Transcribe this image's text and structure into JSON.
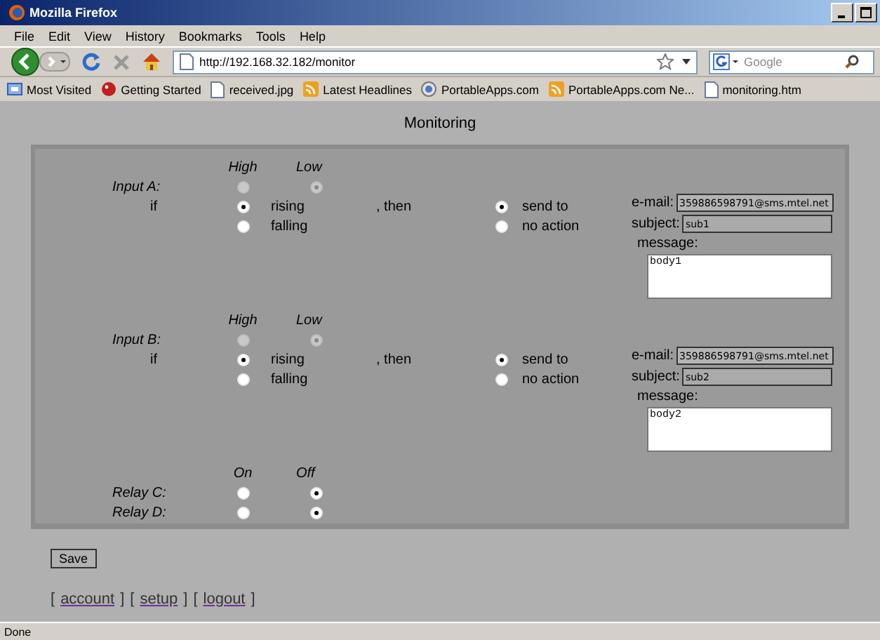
{
  "window": {
    "title": "Mozilla Firefox"
  },
  "menu": [
    "File",
    "Edit",
    "View",
    "History",
    "Bookmarks",
    "Tools",
    "Help"
  ],
  "address": {
    "value": "http://192.168.32.182/monitor"
  },
  "search": {
    "placeholder": "Google"
  },
  "bookmarks": [
    {
      "label": "Most Visited",
      "kind": "smart"
    },
    {
      "label": "Getting Started",
      "kind": "start"
    },
    {
      "label": "received.jpg",
      "kind": "page"
    },
    {
      "label": "Latest Headlines",
      "kind": "feed"
    },
    {
      "label": "PortableApps.com",
      "kind": "globe"
    },
    {
      "label": "PortableApps.com Ne...",
      "kind": "feed"
    },
    {
      "label": "monitoring.htm",
      "kind": "page"
    }
  ],
  "page": {
    "title": "Monitoring"
  },
  "inputs": [
    {
      "label": "Input A:",
      "state_options": [
        {
          "label": "High",
          "selected": false,
          "disabled": true
        },
        {
          "label": "Low",
          "selected": true,
          "disabled": true
        }
      ],
      "if_label": "if",
      "conditions": [
        {
          "label": "rising",
          "selected": true
        },
        {
          "label": "falling",
          "selected": false
        }
      ],
      "then_label": ", then",
      "actions": [
        {
          "label": "send to",
          "selected": true
        },
        {
          "label": "no action",
          "selected": false
        }
      ],
      "email": {
        "label": "e-mail:",
        "value": "359886598791@sms.mtel.net"
      },
      "subject": {
        "label": "subject:",
        "value": "sub1"
      },
      "message": {
        "label": "message:",
        "value": "body1"
      }
    },
    {
      "label": "Input B:",
      "state_options": [
        {
          "label": "High",
          "selected": false,
          "disabled": true
        },
        {
          "label": "Low",
          "selected": true,
          "disabled": true
        }
      ],
      "if_label": "if",
      "conditions": [
        {
          "label": "rising",
          "selected": true
        },
        {
          "label": "falling",
          "selected": false
        }
      ],
      "then_label": ", then",
      "actions": [
        {
          "label": "send to",
          "selected": true
        },
        {
          "label": "no action",
          "selected": false
        }
      ],
      "email": {
        "label": "e-mail:",
        "value": "359886598791@sms.mtel.net"
      },
      "subject": {
        "label": "subject:",
        "value": "sub2"
      },
      "message": {
        "label": "message:",
        "value": "body2"
      }
    }
  ],
  "relays": {
    "columns": [
      "On",
      "Off"
    ],
    "rows": [
      {
        "label": "Relay C:",
        "options": [
          {
            "selected": false
          },
          {
            "selected": true
          }
        ]
      },
      {
        "label": "Relay D:",
        "options": [
          {
            "selected": false
          },
          {
            "selected": true
          }
        ]
      }
    ]
  },
  "save_button": "Save",
  "links": [
    {
      "before": "[",
      "label": "account",
      "after": "]"
    },
    {
      "before": "[",
      "label": "setup",
      "after": "]"
    },
    {
      "before": "[",
      "label": "logout",
      "after": "]"
    }
  ],
  "status_bar": "Done"
}
